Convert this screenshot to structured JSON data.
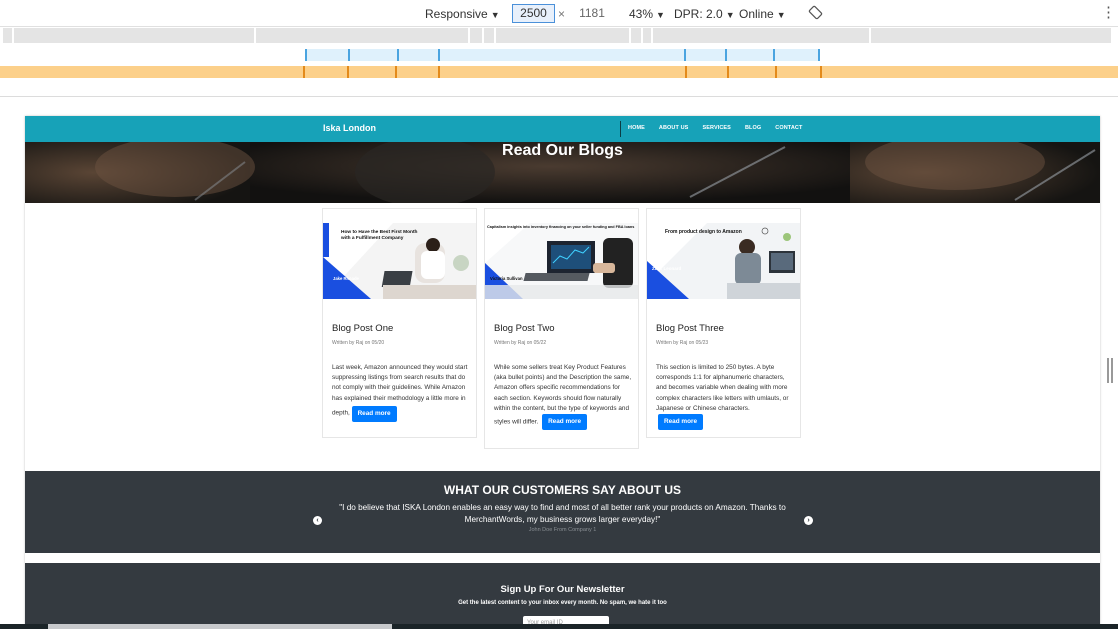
{
  "devtools": {
    "device": "Responsive",
    "width": "2500",
    "times": "×",
    "height": "1181",
    "zoom": "43%",
    "dpr": "DPR: 2.0",
    "network": "Online",
    "more": "⋮"
  },
  "navbar": {
    "brand": "Iska London",
    "links": [
      "HOME",
      "ABOUT US",
      "SERVICES",
      "BLOG",
      "CONTACT"
    ]
  },
  "hero": {
    "title": "Read Our Blogs"
  },
  "posts": [
    {
      "image_headline": "How to Have the Best First Month with a Fulfillment Company",
      "image_caption": "Jake Rhoade",
      "title": "Blog Post One",
      "meta": "Written by Raj on 05/20",
      "text": "Last week, Amazon announced they would start suppressing listings from search results that do not comply with their guidelines. While Amazon has explained their methodology a little more in depth,",
      "button": "Read more"
    },
    {
      "image_headline": "Capitalism insights into inventory financing on your seller funding and FBA loans",
      "image_caption": "Victoria Sullivan",
      "title": "Blog Post Two",
      "meta": "Written by Raj on 05/22",
      "text": "While some sellers treat Key Product Features (aka bullet points) and the Description the same, Amazon offers specific recommendations for each section. Keywords should flow naturally within the content, but the type of keywords and styles will differ.",
      "button": "Read more"
    },
    {
      "image_headline": "From product design to Amazon",
      "image_caption": "Zack Leonard",
      "title": "Blog Post Three",
      "meta": "Written by Raj on 05/23",
      "text": "This section is limited to 250 bytes. A byte corresponds 1:1 for alphanumeric characters, and becomes variable when dealing with more complex characters like letters with umlauts, or Japanese or Chinese characters.",
      "button": "Read more"
    }
  ],
  "testimonials": {
    "title": "WHAT OUR CUSTOMERS SAY ABOUT US",
    "quote": "\"I do believe that ISKA London enables an easy way to find and most of all better rank your products on Amazon. Thanks to MerchantWords, my business grows larger everyday!\"",
    "author": "John Doe From Company 1",
    "prev": "‹",
    "next": "›"
  },
  "newsletter": {
    "title": "Sign Up For Our Newsletter",
    "subtitle": "Get the latest content to your inbox every month. No spam, we hate it too",
    "placeholder": "Your email ID"
  },
  "colors": {
    "navbar": "#17a2b8",
    "dark": "#343a40",
    "button": "#007bff",
    "card_blue": "#1a4fe0"
  }
}
